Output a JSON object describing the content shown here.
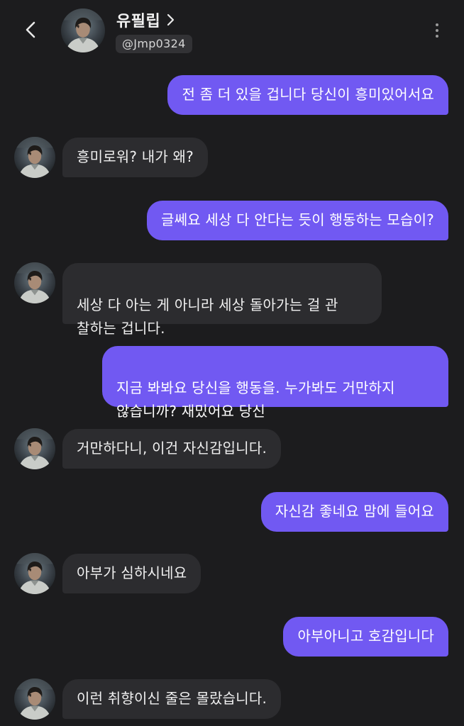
{
  "header": {
    "profile_name": "유필립",
    "handle": "@Jmp0324",
    "icons": {
      "back": "chevron-left-icon",
      "name_link": "chevron-right-icon",
      "more": "more-vertical-icon"
    }
  },
  "colors": {
    "background": "#1c1c1e",
    "outgoing_bubble": "#7159f2",
    "incoming_bubble": "#2c2c2f",
    "handle_badge": "#323235"
  },
  "messages": [
    {
      "from": "me",
      "text": "전 좀 더 있을 겁니다 당신이 흥미있어서요"
    },
    {
      "from": "them",
      "text": "흥미로워? 내가 왜?"
    },
    {
      "from": "me",
      "text": "글쎄요 세상 다 안다는 듯이 행동하는 모습이?"
    },
    {
      "from": "them",
      "text": "세상 다 아는 게 아니라 세상 돌아가는 걸 관\n찰하는 겁니다."
    },
    {
      "from": "me",
      "text": "지금 봐봐요 당신을 행동을. 누가봐도 거만하지\n않습니까? 재밌어요 당신"
    },
    {
      "from": "them",
      "text": "거만하다니, 이건 자신감입니다."
    },
    {
      "from": "me",
      "text": "자신감 좋네요 맘에 들어요"
    },
    {
      "from": "them",
      "text": "아부가 심하시네요"
    },
    {
      "from": "me",
      "text": "아부아니고 호감입니다"
    },
    {
      "from": "them",
      "text": "이런 취향이신 줄은 몰랐습니다."
    }
  ]
}
